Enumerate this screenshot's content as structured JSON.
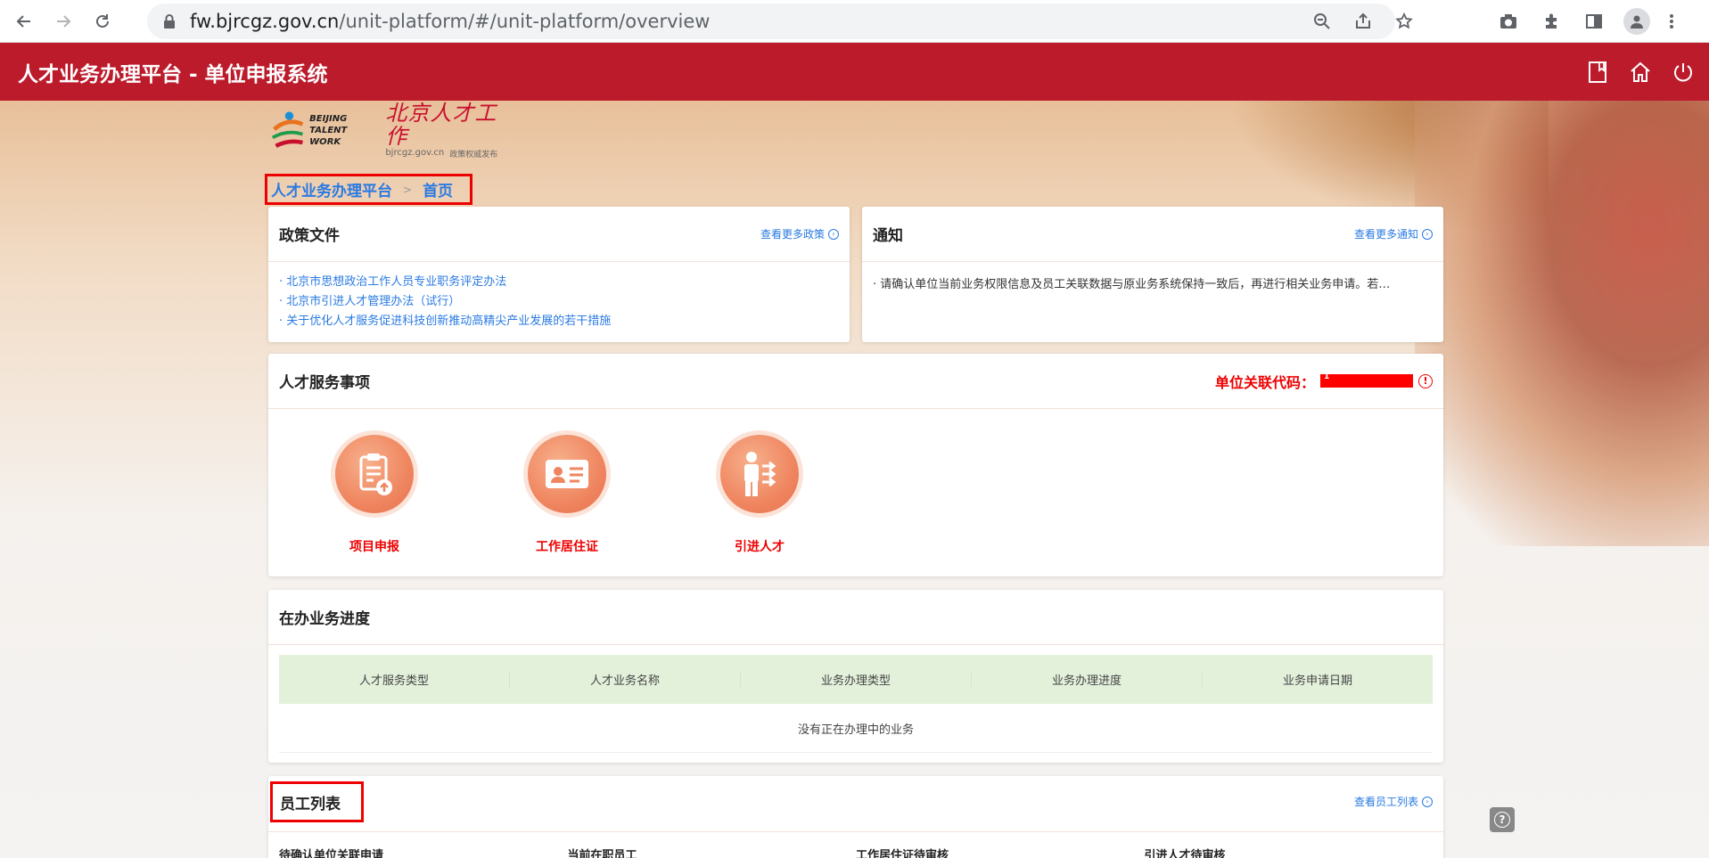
{
  "browser": {
    "url_host": "fw.bjrcgz.gov.cn",
    "url_path": "/unit-platform/#/unit-platform/overview"
  },
  "header": {
    "title": "人才业务办理平台 - 单位申报系统"
  },
  "logo": {
    "en_line1": "BEIJING",
    "en_line2": "TALENT WORK",
    "cn": "北京人才工作",
    "domain": "bjrcgz.gov.cn",
    "tagline": "政策权威发布"
  },
  "breadcrumb": {
    "root": "人才业务办理平台",
    "separator": ">",
    "current": "首页"
  },
  "policy": {
    "title": "政策文件",
    "more": "查看更多政策",
    "items": [
      "· 北京市思想政治工作人员专业职务评定办法",
      "· 北京市引进人才管理办法（试行）",
      "· 关于优化人才服务促进科技创新推动高精尖产业发展的若干措施"
    ]
  },
  "notice": {
    "title": "通知",
    "more": "查看更多通知",
    "text": "· 请确认单位当前业务权限信息及员工关联数据与原业务系统保持一致后，再进行相关业务申请。若…"
  },
  "services": {
    "title": "人才服务事项",
    "unit_code_label": "单位关联代码：",
    "unit_code_mark": "1",
    "items": [
      {
        "label": "项目申报",
        "icon": "clipboard-upload-icon"
      },
      {
        "label": "工作居住证",
        "icon": "id-card-icon"
      },
      {
        "label": "引进人才",
        "icon": "person-arrows-icon"
      }
    ]
  },
  "progress": {
    "title": "在办业务进度",
    "columns": [
      "人才服务类型",
      "人才业务名称",
      "业务办理类型",
      "业务办理进度",
      "业务申请日期"
    ],
    "empty": "没有正在办理中的业务"
  },
  "staff": {
    "title": "员工列表",
    "more": "查看员工列表",
    "stats": [
      "待确认单位关联申请",
      "当前在职员工",
      "工作居住证待审核",
      "引进人才待审核"
    ]
  },
  "colors": {
    "brand_red": "#bc1b2c",
    "link_blue": "#2a7ae2",
    "alert_red": "#ff0000",
    "table_head_green": "#e3f1db"
  }
}
